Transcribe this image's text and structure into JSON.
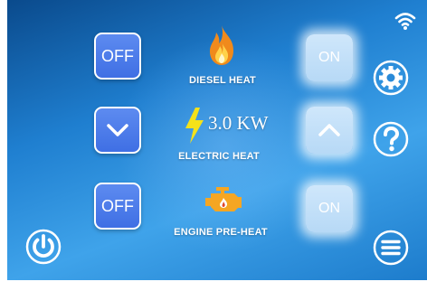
{
  "rows": {
    "diesel": {
      "left_label": "OFF",
      "right_label": "ON",
      "title": "DIESEL HEAT"
    },
    "electric": {
      "power": "3.0 KW",
      "title": "ELECTRIC HEAT"
    },
    "engine": {
      "left_label": "OFF",
      "right_label": "ON",
      "title": "ENGINE PRE-HEAT"
    }
  },
  "icons": {
    "flame": "flame-icon",
    "bolt": "lightning-bolt-icon",
    "engine": "engine-icon",
    "wifi": "wifi-icon",
    "settings": "gear-icon",
    "help": "question-icon",
    "power": "power-icon",
    "menu": "menu-icon",
    "chevron_down": "chevron-down-icon",
    "chevron_up": "chevron-up-icon"
  },
  "colors": {
    "accent_blue": "#3f6fe4",
    "flame_orange": "#f08a1c",
    "bolt_yellow": "#f4e21a",
    "engine_orange": "#f5a623"
  }
}
